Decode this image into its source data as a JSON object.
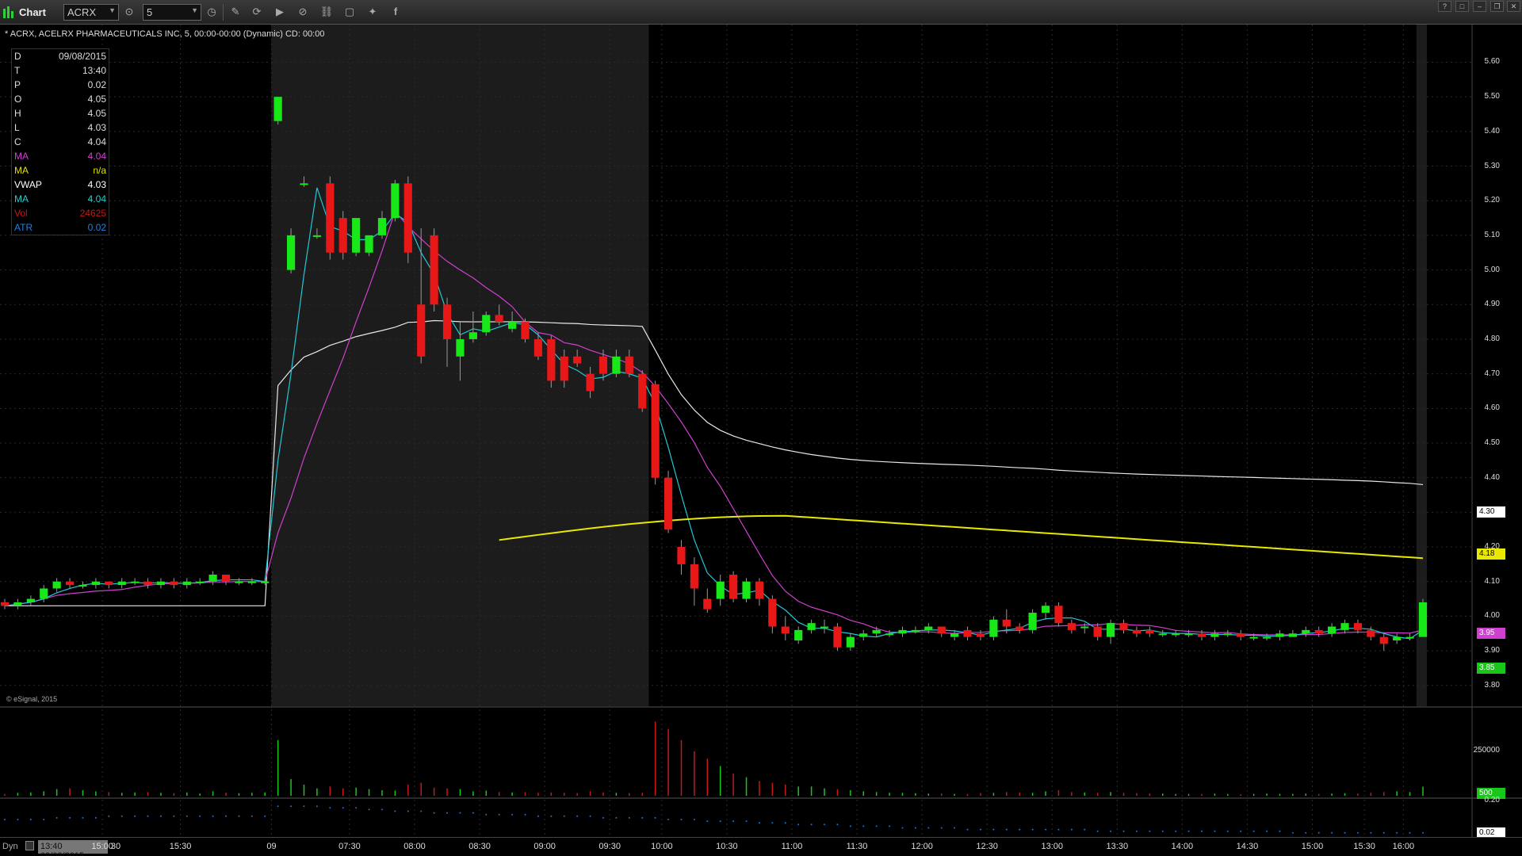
{
  "window": {
    "title": "Chart",
    "symbol_input": "ACRX",
    "interval_input": "5"
  },
  "chart_header": "* ACRX, ACELRX PHARMACEUTICALS INC, 5, 00:00-00:00 (Dynamic) CD: 00:00",
  "data_window": [
    {
      "key": "D",
      "value": "09/08/2015",
      "color": "#dddddd"
    },
    {
      "key": "T",
      "value": "13:40",
      "color": "#dddddd"
    },
    {
      "key": "P",
      "value": "0.02",
      "color": "#dddddd"
    },
    {
      "key": "O",
      "value": "4.05",
      "color": "#dddddd"
    },
    {
      "key": "H",
      "value": "4.05",
      "color": "#dddddd"
    },
    {
      "key": "L",
      "value": "4.03",
      "color": "#dddddd"
    },
    {
      "key": "C",
      "value": "4.04",
      "color": "#dddddd"
    },
    {
      "key": "MA",
      "value": "4.04",
      "color": "#d040d0"
    },
    {
      "key": "MA",
      "value": "n/a",
      "color": "#e0e000"
    },
    {
      "key": "VWAP",
      "value": "4.03",
      "color": "#ffffff"
    },
    {
      "key": "MA",
      "value": "4.04",
      "color": "#20d0d0"
    },
    {
      "key": "Vol",
      "value": "24625",
      "color": "#c81818"
    },
    {
      "key": "ATR",
      "value": "0.02",
      "color": "#2080e0"
    }
  ],
  "credit": "© eSignal, 2015",
  "price_axis": {
    "labels": [
      "5.60",
      "5.50",
      "5.40",
      "5.30",
      "5.20",
      "5.10",
      "5.00",
      "4.90",
      "4.80",
      "4.70",
      "4.60",
      "4.50",
      "4.40",
      "4.30",
      "4.20",
      "4.10",
      "4.00",
      "3.90",
      "3.80"
    ],
    "tags": [
      {
        "value": "4.30",
        "bg": "#ffffff",
        "fg": "#000000",
        "price": 4.3
      },
      {
        "value": "4.18",
        "bg": "#e8e800",
        "fg": "#000000",
        "price": 4.18
      },
      {
        "value": "3.95",
        "bg": "#d040d0",
        "fg": "#ffffff",
        "price": 3.95
      },
      {
        "value": "3.85",
        "bg": "#18c818",
        "fg": "#ffffff",
        "price": 3.85
      }
    ]
  },
  "volume_axis": {
    "label_250k": "250000",
    "tag_500": "500"
  },
  "atr_axis": {
    "label_top": "0.20",
    "tag": "0.02"
  },
  "time_axis": [
    "15:00",
    "15:30",
    "09",
    "07:30",
    "08:00",
    "08:30",
    "09:00",
    "09:30",
    "10:00",
    "10:30",
    "11:00",
    "11:30",
    "12:00",
    "12:30",
    "13:00",
    "13:30",
    "14:00",
    "14:30",
    "15:00",
    "15:30",
    "16:00"
  ],
  "time_axis_first": "30",
  "bottom": {
    "mode": "Dyn",
    "cursor_time": "13:40 09/08/2015"
  },
  "colors": {
    "up": "#18e818",
    "down": "#e81818",
    "ma_magenta": "#d040d0",
    "ma_cyan": "#20c8d8",
    "vwap": "#e8e8e8",
    "ma_yellow": "#e8e800",
    "volume_up": "#18c818",
    "volume_down": "#c81818",
    "atr": "#2070e0",
    "shade": "#1c1c1c"
  },
  "chart_data": {
    "type": "candlestick",
    "symbol": "ACRX",
    "price_range": [
      3.74,
      5.64
    ],
    "shaded_sessions": [
      "pre-market",
      "after-hours"
    ],
    "candles": {
      "open": [
        4.04,
        4.03,
        4.04,
        4.05,
        4.08,
        4.1,
        4.09,
        4.09,
        4.1,
        4.09,
        4.1,
        4.1,
        4.09,
        4.1,
        4.09,
        4.1,
        4.1,
        4.12,
        4.1,
        4.1,
        4.1,
        5.43,
        5.0,
        5.25,
        5.1,
        5.25,
        5.15,
        5.05,
        5.05,
        5.1,
        5.15,
        5.25,
        4.9,
        5.1,
        4.9,
        4.75,
        4.8,
        4.82,
        4.87,
        4.83,
        4.85,
        4.8,
        4.8,
        4.75,
        4.75,
        4.7,
        4.75,
        4.7,
        4.75,
        4.7,
        4.67,
        4.4,
        4.2,
        4.15,
        4.05,
        4.05,
        4.12,
        4.05,
        4.1,
        4.05,
        3.97,
        3.93,
        3.96,
        3.97,
        3.97,
        3.91,
        3.94,
        3.95,
        3.95,
        3.95,
        3.96,
        3.96,
        3.97,
        3.94,
        3.96,
        3.95,
        3.94,
        3.99,
        3.97,
        3.96,
        4.01,
        4.03,
        3.98,
        3.97,
        3.97,
        3.94,
        3.98,
        3.96,
        3.96,
        3.95,
        3.95,
        3.95,
        3.95,
        3.94,
        3.95,
        3.95,
        3.94,
        3.94,
        3.94,
        3.94,
        3.95,
        3.96,
        3.95,
        3.96,
        3.98,
        3.96,
        3.94,
        3.93,
        3.94,
        3.94
      ],
      "close": [
        4.03,
        4.04,
        4.05,
        4.08,
        4.1,
        4.09,
        4.09,
        4.1,
        4.09,
        4.1,
        4.1,
        4.09,
        4.1,
        4.09,
        4.1,
        4.1,
        4.12,
        4.1,
        4.1,
        4.1,
        4.1,
        5.5,
        5.1,
        5.25,
        5.1,
        5.05,
        5.05,
        5.15,
        5.1,
        5.15,
        5.25,
        5.05,
        4.75,
        4.9,
        4.8,
        4.8,
        4.82,
        4.87,
        4.85,
        4.85,
        4.8,
        4.75,
        4.68,
        4.68,
        4.73,
        4.65,
        4.7,
        4.75,
        4.7,
        4.6,
        4.4,
        4.25,
        4.15,
        4.08,
        4.02,
        4.1,
        4.05,
        4.1,
        4.05,
        3.97,
        3.95,
        3.96,
        3.98,
        3.97,
        3.91,
        3.94,
        3.95,
        3.96,
        3.95,
        3.96,
        3.96,
        3.97,
        3.95,
        3.95,
        3.94,
        3.94,
        3.99,
        3.97,
        3.96,
        4.01,
        4.03,
        3.98,
        3.96,
        3.97,
        3.94,
        3.98,
        3.96,
        3.95,
        3.95,
        3.95,
        3.95,
        3.95,
        3.94,
        3.95,
        3.95,
        3.94,
        3.94,
        3.94,
        3.95,
        3.95,
        3.96,
        3.95,
        3.97,
        3.98,
        3.96,
        3.94,
        3.92,
        3.94,
        3.94,
        4.04
      ],
      "high": [
        4.05,
        4.05,
        4.06,
        4.09,
        4.11,
        4.11,
        4.1,
        4.11,
        4.1,
        4.11,
        4.11,
        4.11,
        4.11,
        4.11,
        4.11,
        4.11,
        4.13,
        4.12,
        4.11,
        4.11,
        4.11,
        5.5,
        5.12,
        5.27,
        5.12,
        5.27,
        5.17,
        5.12,
        5.1,
        5.17,
        5.26,
        5.27,
        5.12,
        5.12,
        4.92,
        4.85,
        4.88,
        4.88,
        4.9,
        4.88,
        4.86,
        4.82,
        4.81,
        4.77,
        4.77,
        4.72,
        4.77,
        4.77,
        4.77,
        4.71,
        4.68,
        4.42,
        4.22,
        4.17,
        4.08,
        4.12,
        4.13,
        4.11,
        4.11,
        4.06,
        4.0,
        3.97,
        3.99,
        3.99,
        3.98,
        3.95,
        3.96,
        3.97,
        3.96,
        3.97,
        3.97,
        3.98,
        3.97,
        3.96,
        3.97,
        3.96,
        4.0,
        4.02,
        3.98,
        4.02,
        4.04,
        4.04,
        3.99,
        3.98,
        3.98,
        3.99,
        3.99,
        3.97,
        3.97,
        3.96,
        3.96,
        3.96,
        3.96,
        3.96,
        3.96,
        3.96,
        3.95,
        3.95,
        3.96,
        3.96,
        3.97,
        3.97,
        3.98,
        3.99,
        3.99,
        3.97,
        3.95,
        3.95,
        3.95,
        4.05
      ],
      "low": [
        4.02,
        4.02,
        4.03,
        4.04,
        4.07,
        4.08,
        4.08,
        4.08,
        4.08,
        4.08,
        4.09,
        4.08,
        4.08,
        4.08,
        4.08,
        4.09,
        4.09,
        4.09,
        4.09,
        4.09,
        4.09,
        5.42,
        4.99,
        5.24,
        5.09,
        5.03,
        5.03,
        5.04,
        5.04,
        5.09,
        5.14,
        5.02,
        4.73,
        4.88,
        4.72,
        4.68,
        4.79,
        4.81,
        4.84,
        4.82,
        4.79,
        4.74,
        4.66,
        4.66,
        4.72,
        4.63,
        4.68,
        4.69,
        4.69,
        4.59,
        4.38,
        4.24,
        4.12,
        4.03,
        4.01,
        4.03,
        4.04,
        4.04,
        4.03,
        3.95,
        3.93,
        3.92,
        3.95,
        3.95,
        3.9,
        3.9,
        3.93,
        3.94,
        3.94,
        3.94,
        3.95,
        3.95,
        3.94,
        3.93,
        3.93,
        3.93,
        3.93,
        3.95,
        3.95,
        3.95,
        3.99,
        3.97,
        3.95,
        3.95,
        3.93,
        3.92,
        3.95,
        3.94,
        3.94,
        3.94,
        3.94,
        3.94,
        3.93,
        3.93,
        3.94,
        3.93,
        3.93,
        3.93,
        3.93,
        3.94,
        3.94,
        3.94,
        3.94,
        3.95,
        3.95,
        3.93,
        3.9,
        3.92,
        3.93,
        4.03
      ]
    },
    "volume": [
      5000,
      8000,
      9000,
      12000,
      18000,
      20000,
      15000,
      12000,
      10000,
      8000,
      9000,
      10000,
      8000,
      7000,
      9000,
      6000,
      12000,
      8000,
      7000,
      8000,
      9000,
      150000,
      45000,
      30000,
      20000,
      25000,
      20000,
      22000,
      18000,
      15000,
      14000,
      30000,
      35000,
      22000,
      20000,
      18000,
      12000,
      14000,
      10000,
      9000,
      10000,
      8000,
      9000,
      8000,
      7000,
      12000,
      9000,
      8000,
      7000,
      8000,
      200000,
      180000,
      150000,
      120000,
      100000,
      80000,
      60000,
      50000,
      40000,
      35000,
      30000,
      25000,
      25000,
      20000,
      18000,
      15000,
      12000,
      10000,
      8000,
      8000,
      7000,
      6000,
      6000,
      5000,
      5000,
      7000,
      8000,
      10000,
      9000,
      8000,
      12000,
      15000,
      10000,
      9000,
      8000,
      10000,
      8000,
      7000,
      6000,
      6000,
      5000,
      5000,
      5000,
      6000,
      5000,
      4000,
      5000,
      6000,
      5000,
      5000,
      6000,
      5000,
      6000,
      7000,
      6000,
      8000,
      10000,
      12000,
      10000,
      24625
    ],
    "atr": [
      0.1,
      0.1,
      0.1,
      0.1,
      0.11,
      0.11,
      0.11,
      0.11,
      0.12,
      0.12,
      0.12,
      0.12,
      0.12,
      0.12,
      0.12,
      0.12,
      0.12,
      0.12,
      0.12,
      0.12,
      0.12,
      0.18,
      0.18,
      0.18,
      0.18,
      0.17,
      0.17,
      0.17,
      0.16,
      0.16,
      0.15,
      0.15,
      0.15,
      0.14,
      0.14,
      0.14,
      0.14,
      0.13,
      0.13,
      0.13,
      0.13,
      0.12,
      0.12,
      0.12,
      0.12,
      0.12,
      0.11,
      0.11,
      0.11,
      0.11,
      0.11,
      0.1,
      0.1,
      0.1,
      0.09,
      0.09,
      0.09,
      0.09,
      0.08,
      0.08,
      0.08,
      0.07,
      0.07,
      0.07,
      0.07,
      0.06,
      0.06,
      0.06,
      0.06,
      0.05,
      0.05,
      0.05,
      0.05,
      0.05,
      0.04,
      0.04,
      0.04,
      0.04,
      0.04,
      0.04,
      0.04,
      0.04,
      0.04,
      0.04,
      0.03,
      0.03,
      0.03,
      0.03,
      0.03,
      0.03,
      0.03,
      0.03,
      0.03,
      0.03,
      0.03,
      0.03,
      0.03,
      0.03,
      0.03,
      0.02,
      0.02,
      0.02,
      0.02,
      0.02,
      0.02,
      0.02,
      0.02,
      0.02,
      0.02,
      0.02
    ]
  }
}
